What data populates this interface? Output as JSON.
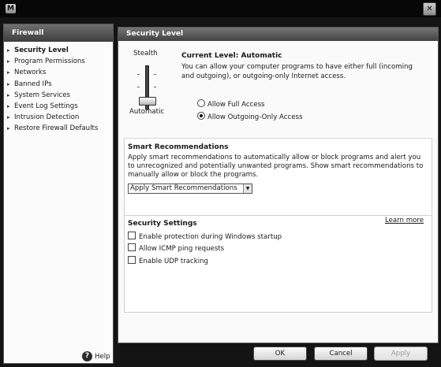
{
  "window": {
    "logo_letter": "M",
    "close_glyph": "✕"
  },
  "sidebar": {
    "title": "Firewall",
    "items": [
      {
        "label": "Security Level",
        "active": true
      },
      {
        "label": "Program Permissions"
      },
      {
        "label": "Networks"
      },
      {
        "label": "Banned IPs"
      },
      {
        "label": "System Services"
      },
      {
        "label": "Event Log Settings"
      },
      {
        "label": "Intrusion Detection"
      },
      {
        "label": "Restore Firewall Defaults"
      }
    ],
    "help_label": "Help",
    "help_icon": "?"
  },
  "panel": {
    "title": "Security Level",
    "slider": {
      "top_label": "Stealth",
      "bottom_label": "Automatic"
    },
    "current_level": "Current Level: Automatic",
    "description": "You can allow your computer programs to have either full (incoming and outgoing), or outgoing-only Internet access.",
    "options": [
      {
        "label": "Allow Full Access",
        "checked": false
      },
      {
        "label": "Allow Outgoing-Only Access",
        "checked": true
      }
    ],
    "smart": {
      "title": "Smart Recommendations",
      "description": "Apply smart recommendations to automatically allow or block programs and alert you to unrecognized and potentially unwanted programs. Show smart recommendations to manually allow or block the programs.",
      "selected": "Apply Smart Recommendations"
    },
    "security": {
      "title": "Security Settings",
      "learn_more": "Learn more",
      "options": [
        {
          "label": "Enable protection during Windows startup",
          "checked": false
        },
        {
          "label": "Allow ICMP ping requests",
          "checked": false
        },
        {
          "label": "Enable UDP tracking",
          "checked": false
        }
      ]
    }
  },
  "buttons": {
    "ok": "OK",
    "cancel": "Cancel",
    "apply": "Apply"
  }
}
